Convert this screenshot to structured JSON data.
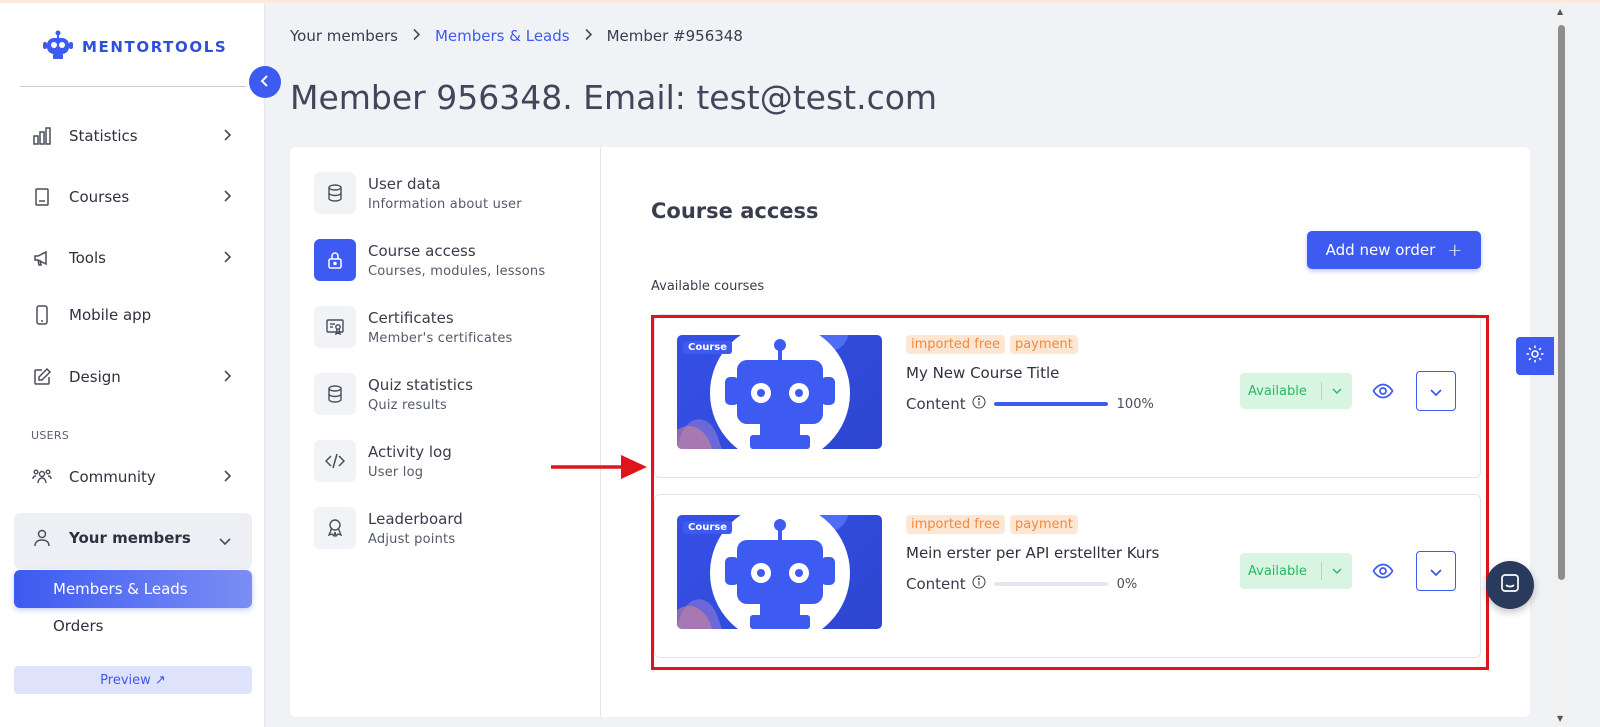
{
  "app": {
    "logo_text": "MENTORTOOLS",
    "brand_color": "#3d5af1"
  },
  "sidebar": {
    "items": [
      {
        "label": "Statistics",
        "icon": "bar-chart-icon"
      },
      {
        "label": "Courses",
        "icon": "book-icon"
      },
      {
        "label": "Tools",
        "icon": "megaphone-icon"
      },
      {
        "label": "Mobile app",
        "icon": "phone-icon"
      },
      {
        "label": "Design",
        "icon": "pencil-icon"
      }
    ],
    "section_users": "USERS",
    "community": "Community",
    "your_members": "Your members",
    "members_leads": "Members & Leads",
    "orders": "Orders",
    "preview": "Preview ↗"
  },
  "breadcrumb": {
    "items": [
      "Your members",
      "Members & Leads",
      "Member #956348"
    ]
  },
  "page_title": "Member 956348. Email: test@test.com",
  "tabs": [
    {
      "title": "User data",
      "subtitle": "Information about user",
      "icon": "database-icon"
    },
    {
      "title": "Course access",
      "subtitle": "Courses, modules, lessons",
      "icon": "lock-icon"
    },
    {
      "title": "Certificates",
      "subtitle": "Member's certificates",
      "icon": "certificate-icon"
    },
    {
      "title": "Quiz statistics",
      "subtitle": "Quiz results",
      "icon": "database-icon"
    },
    {
      "title": "Activity log",
      "subtitle": "User log",
      "icon": "code-icon"
    },
    {
      "title": "Leaderboard",
      "subtitle": "Adjust points",
      "icon": "award-icon"
    }
  ],
  "course_access": {
    "title": "Course access",
    "add_order": "Add new order",
    "available_label": "Available courses",
    "courses": [
      {
        "badge": "Course",
        "tags": [
          "imported free",
          "payment"
        ],
        "name": "My New Course Title",
        "content_label": "Content",
        "progress": 100,
        "progress_text": "100%",
        "status": "Available"
      },
      {
        "badge": "Course",
        "tags": [
          "imported free",
          "payment"
        ],
        "name": "Mein erster per API erstellter Kurs",
        "content_label": "Content",
        "progress": 0,
        "progress_text": "0%",
        "status": "Available"
      }
    ]
  },
  "colors": {
    "tag_bg": "#fde6d4",
    "tag_text": "#f08a3e",
    "status_bg": "#d8f5e1",
    "status_text": "#28b862",
    "annotation": "#e0141b"
  }
}
